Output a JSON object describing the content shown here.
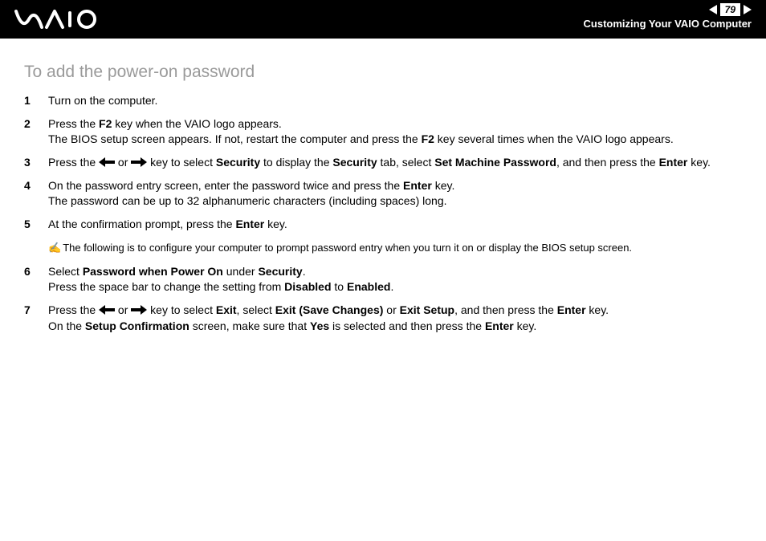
{
  "header": {
    "page_number": "79",
    "section": "Customizing Your VAIO Computer"
  },
  "heading": "To add the power-on password",
  "steps": {
    "s1": {
      "num": "1",
      "text": "Turn on the computer."
    },
    "s2": {
      "num": "2",
      "t1": "Press the ",
      "b1": "F2",
      "t2": " key when the VAIO logo appears.",
      "t3": "The BIOS setup screen appears. If not, restart the computer and press the ",
      "b2": "F2",
      "t4": " key several times when the VAIO logo appears."
    },
    "s3": {
      "num": "3",
      "t1": "Press the ",
      "t2": " or ",
      "t3": " key to select ",
      "b1": "Security",
      "t4": " to display the ",
      "b2": "Security",
      "t5": " tab, select ",
      "b3": "Set Machine Password",
      "t6": ", and then press the ",
      "b4": "Enter",
      "t7": " key."
    },
    "s4": {
      "num": "4",
      "t1": "On the password entry screen, enter the password twice and press the ",
      "b1": "Enter",
      "t2": " key.",
      "t3": "The password can be up to 32 alphanumeric characters (including spaces) long."
    },
    "s5": {
      "num": "5",
      "t1": "At the confirmation prompt, press the ",
      "b1": "Enter",
      "t2": " key."
    },
    "s6": {
      "num": "6",
      "t1": "Select ",
      "b1": "Password when Power On",
      "t2": " under ",
      "b2": "Security",
      "t3": ".",
      "t4": "Press the space bar to change the setting from ",
      "b3": "Disabled",
      "t5": " to ",
      "b4": "Enabled",
      "t6": "."
    },
    "s7": {
      "num": "7",
      "t1": "Press the ",
      "t2": " or ",
      "t3": " key to select ",
      "b1": "Exit",
      "t4": ", select ",
      "b2": "Exit (Save Changes)",
      "t5": " or ",
      "b3": "Exit Setup",
      "t6": ", and then press the ",
      "b4": "Enter",
      "t7": " key.",
      "t8": "On the ",
      "b5": "Setup Confirmation",
      "t9": " screen, make sure that ",
      "b6": "Yes",
      "t10": " is selected and then press the ",
      "b7": "Enter",
      "t11": " key."
    }
  },
  "note": {
    "icon": "✍",
    "text": "The following is to configure your computer to prompt password entry when you turn it on or display the BIOS setup screen."
  }
}
